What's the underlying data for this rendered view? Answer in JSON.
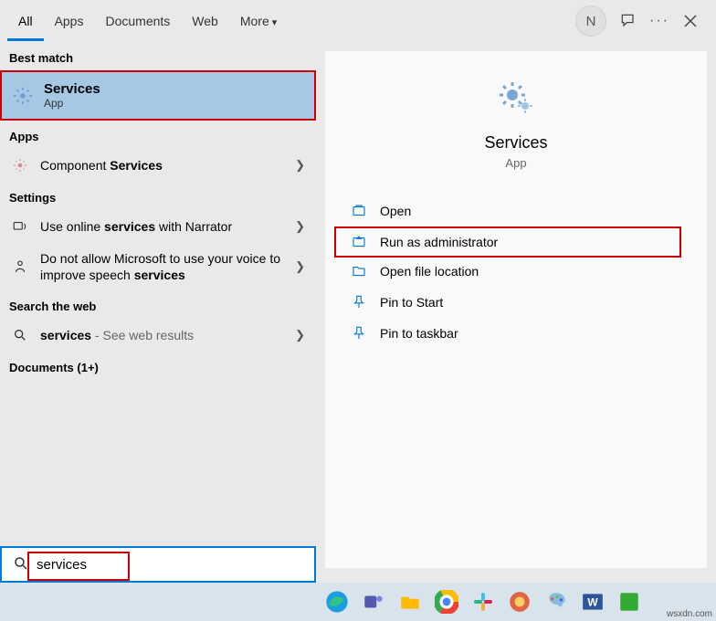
{
  "tabs": {
    "items": [
      "All",
      "Apps",
      "Documents",
      "Web",
      "More"
    ],
    "active_index": 0
  },
  "header": {
    "avatar_initial": "N"
  },
  "left": {
    "best_match_label": "Best match",
    "best": {
      "title": "Services",
      "subtitle": "App"
    },
    "apps_label": "Apps",
    "apps_item_prefix": "Component ",
    "apps_item_bold": "Services",
    "settings_label": "Settings",
    "setting1_pre": "Use online ",
    "setting1_bold": "services",
    "setting1_post": " with Narrator",
    "setting2_pre": "Do not allow Microsoft to use your voice to improve speech ",
    "setting2_bold": "services",
    "web_label": "Search the web",
    "web_item_bold": "services",
    "web_item_post": " - See web results",
    "docs_label": "Documents (1+)"
  },
  "right": {
    "title": "Services",
    "subtitle": "App",
    "actions": {
      "open": "Open",
      "run_admin": "Run as administrator",
      "open_loc": "Open file location",
      "pin_start": "Pin to Start",
      "pin_taskbar": "Pin to taskbar"
    }
  },
  "search": {
    "value": "services"
  },
  "watermark": "wsxdn.com"
}
